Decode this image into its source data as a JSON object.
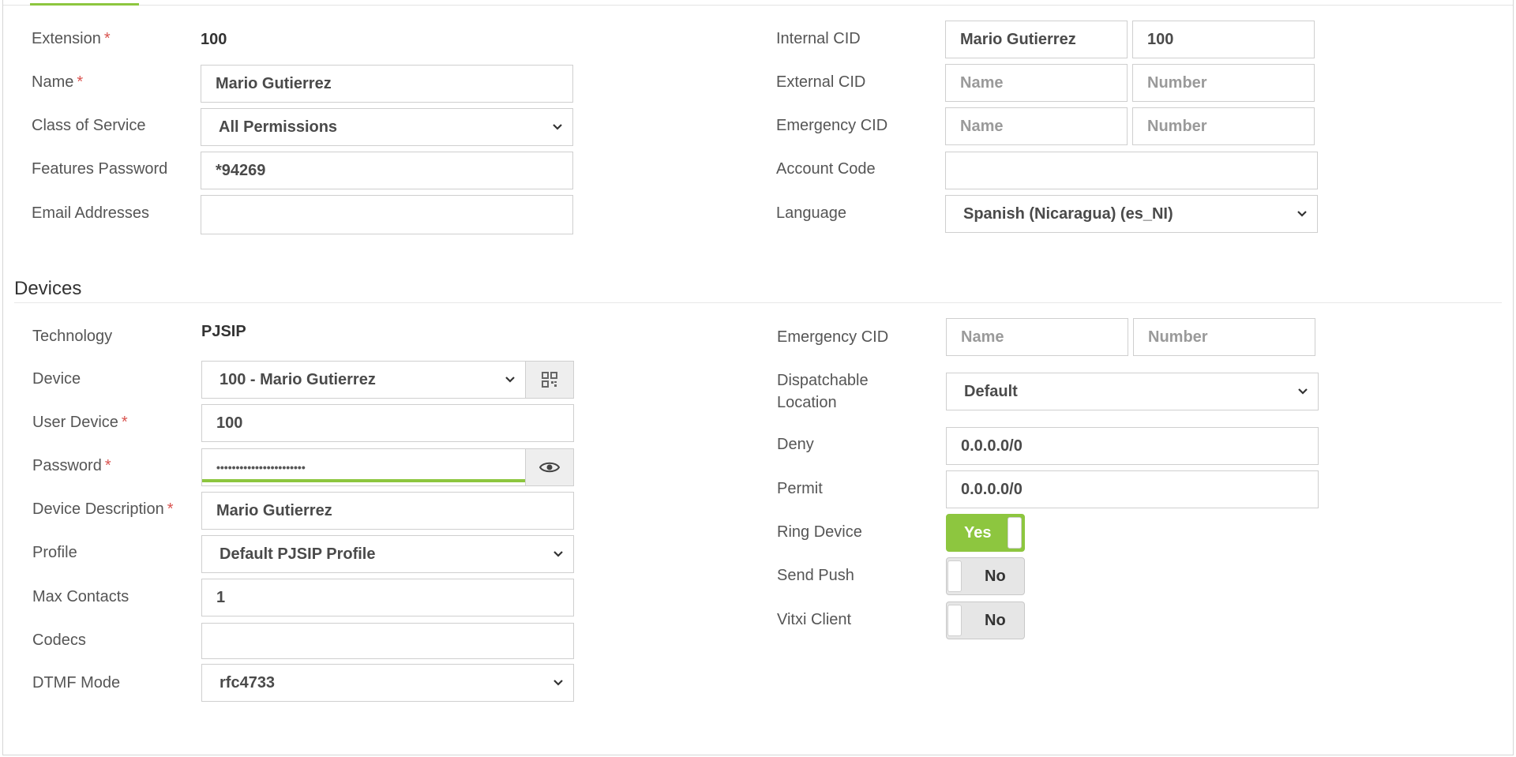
{
  "extension_section": {
    "extension": {
      "label": "Extension",
      "value": "100"
    },
    "name": {
      "label": "Name",
      "value": "Mario Gutierrez"
    },
    "class_of_service": {
      "label": "Class of Service",
      "value": "All Permissions"
    },
    "features_password": {
      "label": "Features Password",
      "value": "*94269"
    },
    "email_addresses": {
      "label": "Email Addresses",
      "value": ""
    },
    "internal_cid": {
      "label": "Internal CID",
      "name": "Mario Gutierrez",
      "number": "100"
    },
    "external_cid": {
      "label": "External CID",
      "name_placeholder": "Name",
      "number_placeholder": "Number"
    },
    "emergency_cid": {
      "label": "Emergency CID",
      "name_placeholder": "Name",
      "number_placeholder": "Number"
    },
    "account_code": {
      "label": "Account Code",
      "value": ""
    },
    "language": {
      "label": "Language",
      "value": "Spanish (Nicaragua) (es_NI)"
    }
  },
  "devices": {
    "title": "Devices",
    "technology": {
      "label": "Technology",
      "value": "PJSIP"
    },
    "device": {
      "label": "Device",
      "value": "100 - Mario Gutierrez"
    },
    "user_device": {
      "label": "User Device",
      "value": "100"
    },
    "password": {
      "label": "Password",
      "value": "•••••••••••••••••••••••"
    },
    "device_description": {
      "label": "Device Description",
      "value": "Mario Gutierrez"
    },
    "profile": {
      "label": "Profile",
      "value": "Default PJSIP Profile"
    },
    "max_contacts": {
      "label": "Max Contacts",
      "value": "1"
    },
    "codecs": {
      "label": "Codecs",
      "value": ""
    },
    "dtmf_mode": {
      "label": "DTMF Mode",
      "value": "rfc4733"
    },
    "emergency_cid": {
      "label": "Emergency CID",
      "name_placeholder": "Name",
      "number_placeholder": "Number"
    },
    "dispatchable_location": {
      "label_line1": "Dispatchable",
      "label_line2": "Location",
      "value": "Default"
    },
    "deny": {
      "label": "Deny",
      "value": "0.0.0.0/0"
    },
    "permit": {
      "label": "Permit",
      "value": "0.0.0.0/0"
    },
    "ring_device": {
      "label": "Ring Device",
      "state": "Yes"
    },
    "send_push": {
      "label": "Send Push",
      "state": "No"
    },
    "vitxi_client": {
      "label": "Vitxi Client",
      "state": "No"
    }
  },
  "colors": {
    "accent": "#8dc63f",
    "required": "#d9534f"
  },
  "icons": {
    "device_addon": "qr-code-icon",
    "password_addon": "eye-icon",
    "select_arrow": "chevron-down-icon"
  }
}
